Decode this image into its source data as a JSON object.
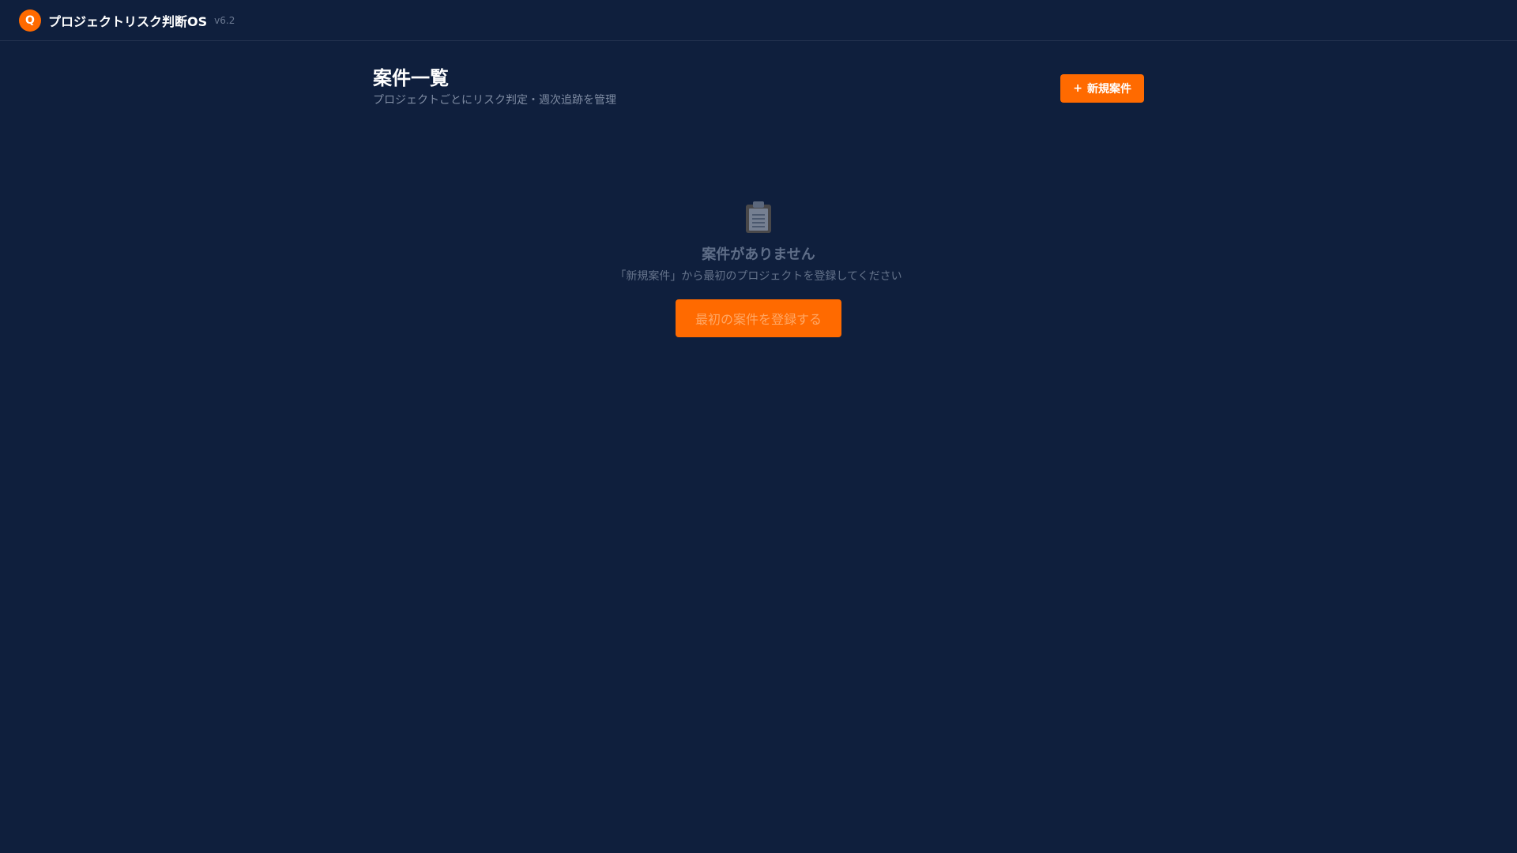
{
  "app": {
    "logo_letter": "Q",
    "title": "プロジェクトリスク判断OS",
    "version": "v6.2"
  },
  "header": {
    "title": "案件一覧",
    "subtitle": "プロジェクトごとにリスク判定・週次追跡を管理",
    "new_button": {
      "icon": "+",
      "label": "新規案件"
    }
  },
  "empty_state": {
    "icon": "clipboard-icon",
    "title": "案件がありません",
    "description": "「新規案件」から最初のプロジェクトを登録してください",
    "button_label": "最初の案件を登録する"
  },
  "colors": {
    "background": "#0f1f3d",
    "accent": "#ff6a00"
  }
}
